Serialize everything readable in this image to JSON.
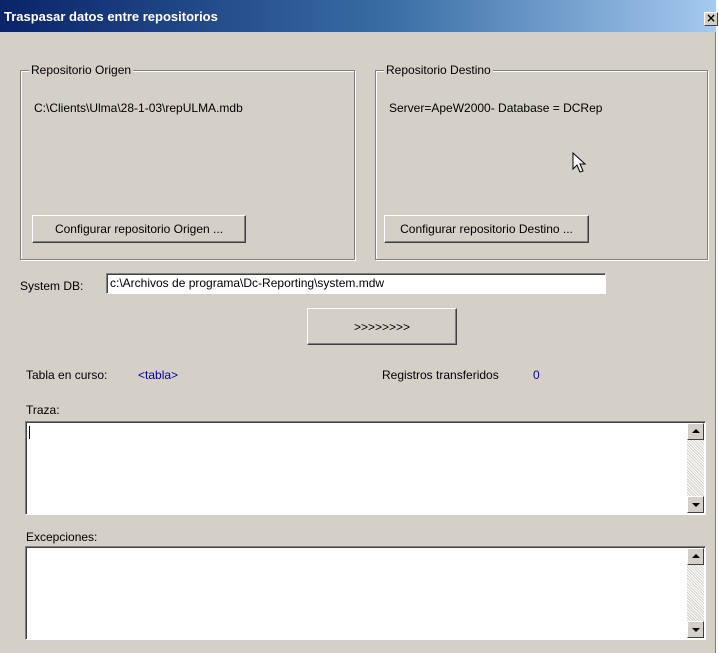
{
  "window": {
    "title": "Traspasar datos entre repositorios",
    "close_glyph": "✕"
  },
  "origen": {
    "group_title": "Repositorio Origen",
    "path": "C:\\Clients\\Ulma\\28-1-03\\repULMA.mdb",
    "button_label": "Configurar repositorio Origen ..."
  },
  "destino": {
    "group_title": "Repositorio Destino",
    "path": "Server=ApeW2000- Database = DCRep",
    "button_label": "Configurar repositorio Destino ..."
  },
  "systemdb": {
    "label": "System DB:",
    "value": "c:\\Archivos de programa\\Dc-Reporting\\system.mdw"
  },
  "transfer": {
    "button_label": ">>>>>>>>"
  },
  "status": {
    "tabla_label": "Tabla en curso:",
    "tabla_value": "<tabla>",
    "registros_label": "Registros transferidos",
    "registros_value": "0"
  },
  "traza": {
    "label": "Traza:",
    "value": ""
  },
  "excepciones": {
    "label": "Excepciones:",
    "value": ""
  },
  "icons": {
    "close": "close-icon",
    "cursor": "mouse-pointer-icon",
    "scroll_up": "scroll-up-arrow-icon",
    "scroll_down": "scroll-down-arrow-icon"
  },
  "colors": {
    "titlebar_start": "#0a246a",
    "titlebar_end": "#a6caf0",
    "face": "#d4d0c8",
    "value_blue": "#00009a"
  }
}
